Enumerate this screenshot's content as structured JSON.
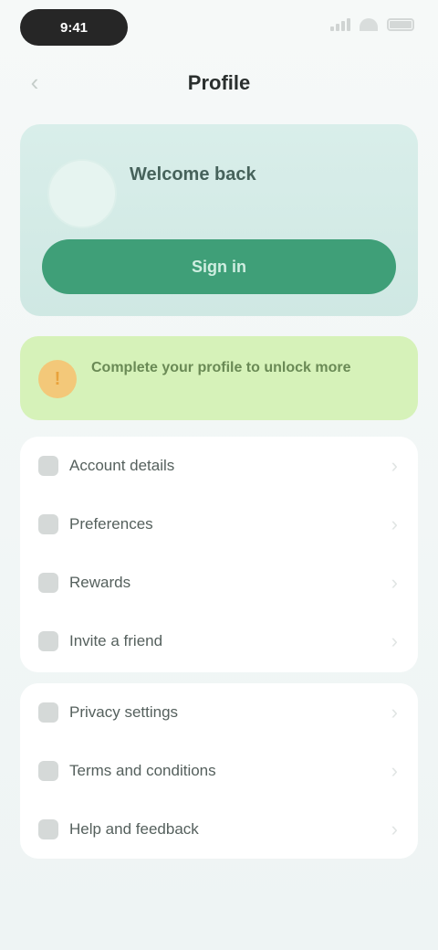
{
  "status": {
    "time": "9:41"
  },
  "nav": {
    "title": "Profile",
    "back_icon": "chevron-left-icon"
  },
  "profile": {
    "name": "Welcome back",
    "subtitle": "",
    "button_label": "Sign in"
  },
  "banner": {
    "icon": "!",
    "title": "Complete your profile to unlock more",
    "subtitle": ""
  },
  "group1": [
    {
      "label": "Account details",
      "icon": "user-icon"
    },
    {
      "label": "Preferences",
      "icon": "settings-icon"
    },
    {
      "label": "Rewards",
      "icon": "gift-icon"
    },
    {
      "label": "Invite a friend",
      "icon": "share-icon"
    }
  ],
  "group2": [
    {
      "label": "Privacy settings",
      "icon": "lock-icon"
    },
    {
      "label": "Terms and conditions",
      "icon": "document-icon"
    },
    {
      "label": "Help and feedback",
      "icon": "help-icon"
    }
  ],
  "colors": {
    "accent": "#3f9f78",
    "card": "#d9eeea",
    "banner": "#d6f2b9"
  }
}
